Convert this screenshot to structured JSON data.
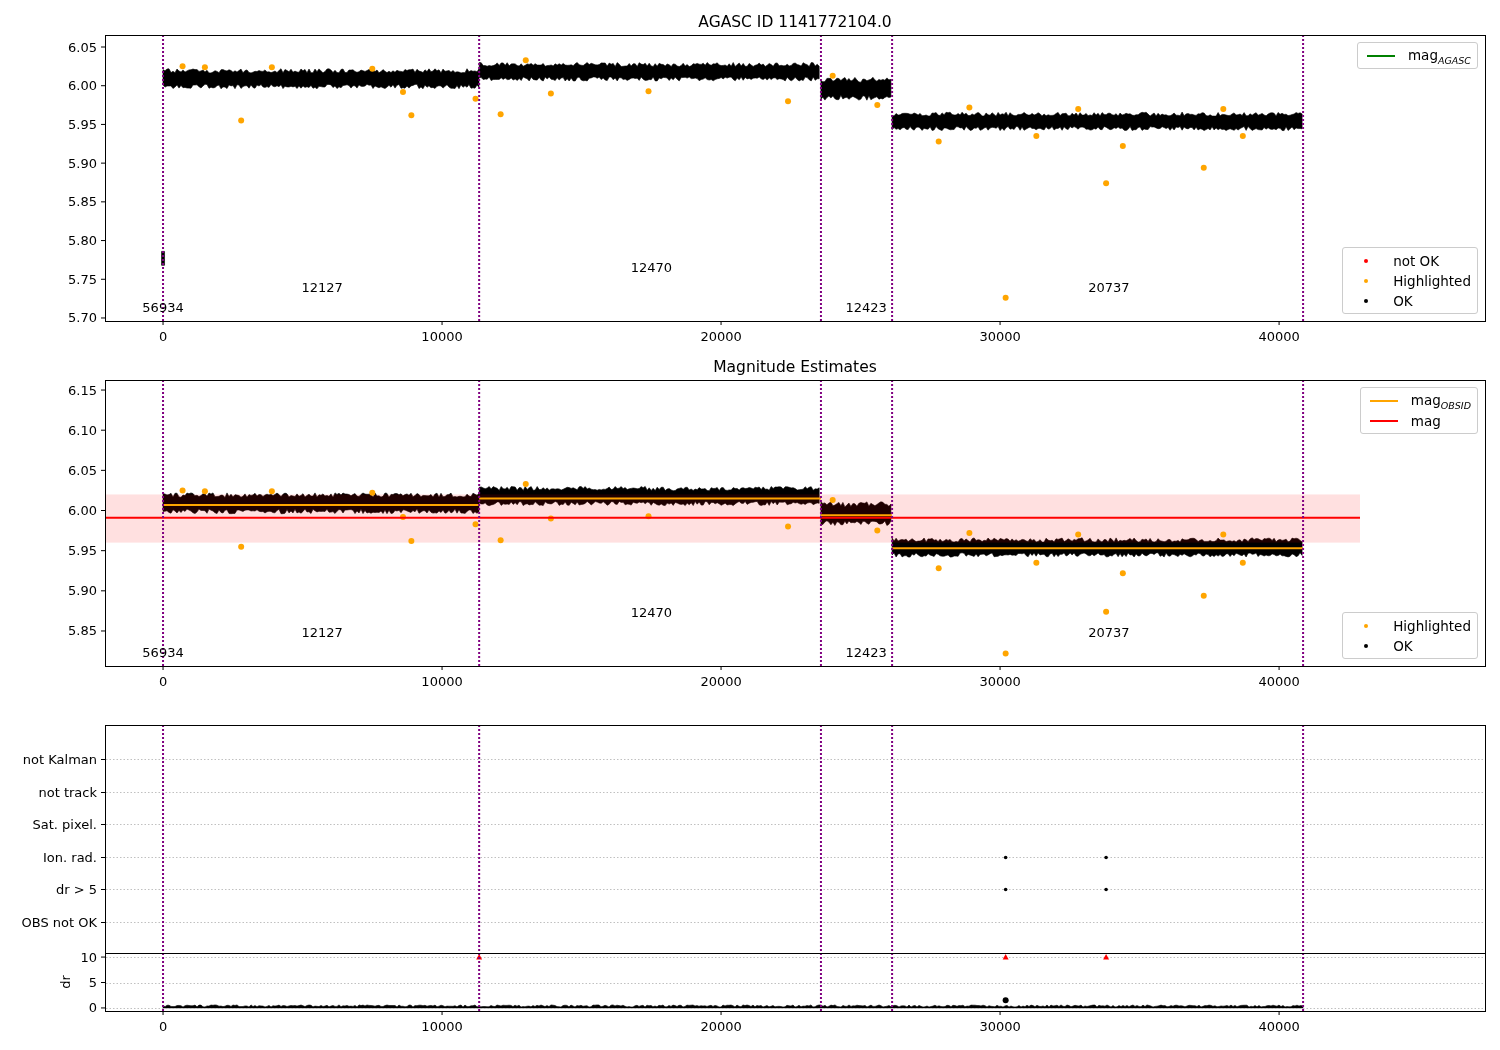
{
  "panels": [
    {
      "kind": "magnitude",
      "chart_data": {
        "type": "scatter",
        "title": "AGASC ID 1141772104.0",
        "xlim": [
          -2080,
          47380
        ],
        "ylim": [
          5.6961,
          6.0655
        ],
        "xticks": [
          {
            "value": 0,
            "label": "0"
          },
          {
            "value": 10000,
            "label": "10000"
          },
          {
            "value": 20000,
            "label": "20000"
          },
          {
            "value": 30000,
            "label": "30000"
          },
          {
            "value": 40000,
            "label": "40000"
          }
        ],
        "yticks": [
          {
            "value": 5.7,
            "label": "5.70"
          },
          {
            "value": 5.75,
            "label": "5.75"
          },
          {
            "value": 5.8,
            "label": "5.80"
          },
          {
            "value": 5.85,
            "label": "5.85"
          },
          {
            "value": 5.9,
            "label": "5.90"
          },
          {
            "value": 5.95,
            "label": "5.95"
          },
          {
            "value": 6.0,
            "label": "6.00"
          },
          {
            "value": 6.05,
            "label": "6.05"
          }
        ],
        "series": [
          {
            "color": "#ffa500",
            "marker": "circle",
            "x": [
              700,
              1500,
              2800,
              3900,
              7500,
              8600,
              8900,
              11200,
              12100,
              13000,
              13900,
              17400,
              22400,
              24000,
              25600,
              27800,
              28900,
              30200,
              31300,
              32800,
              33800,
              34400,
              37300,
              38000,
              38700
            ],
            "values": [
              6.025,
              6.024,
              5.955,
              6.024,
              6.022,
              5.992,
              5.962,
              5.983,
              5.963,
              6.033,
              5.99,
              5.993,
              5.98,
              6.013,
              5.975,
              5.928,
              5.972,
              5.726,
              5.935,
              5.97,
              5.874,
              5.922,
              5.894,
              5.97,
              5.935
            ]
          }
        ],
        "ref_lines": [
          {
            "axis": "x",
            "value": 0
          },
          {
            "axis": "x",
            "value": 11330
          },
          {
            "axis": "x",
            "value": 23580
          },
          {
            "axis": "x",
            "value": 26130
          },
          {
            "axis": "x",
            "value": 40860
          }
        ],
        "annotations": [
          "56934",
          "12127",
          "12470",
          "12423",
          "20737"
        ]
      },
      "legends": [
        {
          "entries": [
            {
              "label": "mag$_{AGASC}$",
              "color": "#008000",
              "kind": "line"
            }
          ]
        },
        {
          "entries": [
            {
              "label": "not OK",
              "color": "#ff0000",
              "kind": "dot"
            },
            {
              "label": "Highlighted",
              "color": "#ffa500",
              "kind": "dot"
            },
            {
              "label": "OK",
              "color": "#000000",
              "kind": "dot"
            }
          ]
        }
      ]
    },
    {
      "kind": "magnitude",
      "chart_data": {
        "type": "scatter",
        "title": "Magnitude Estimates",
        "xlim": [
          -2080,
          47380
        ],
        "ylim": [
          5.8064,
          6.1625
        ],
        "xticks": [
          {
            "value": 0,
            "label": "0"
          },
          {
            "value": 10000,
            "label": "10000"
          },
          {
            "value": 20000,
            "label": "20000"
          },
          {
            "value": 30000,
            "label": "30000"
          },
          {
            "value": 40000,
            "label": "40000"
          }
        ],
        "yticks": [
          {
            "value": 5.85,
            "label": "5.85"
          },
          {
            "value": 5.9,
            "label": "5.90"
          },
          {
            "value": 5.95,
            "label": "5.95"
          },
          {
            "value": 6.0,
            "label": "6.00"
          },
          {
            "value": 6.05,
            "label": "6.05"
          },
          {
            "value": 6.1,
            "label": "6.10"
          },
          {
            "value": 6.15,
            "label": "6.15"
          }
        ],
        "series": [
          {
            "color": "#ffa500",
            "marker": "circle",
            "x": [
              700,
              1500,
              2800,
              3900,
              7500,
              8600,
              8900,
              11200,
              12100,
              13000,
              13900,
              17400,
              22400,
              24000,
              25600,
              27800,
              28900,
              30200,
              31300,
              32800,
              33800,
              34400,
              37300,
              38000,
              38700
            ],
            "values": [
              6.025,
              6.024,
              5.955,
              6.024,
              6.022,
              5.992,
              5.962,
              5.983,
              5.963,
              6.033,
              5.99,
              5.993,
              5.98,
              6.013,
              5.975,
              5.928,
              5.972,
              5.822,
              5.935,
              5.97,
              5.874,
              5.922,
              5.894,
              5.97,
              5.935
            ]
          },
          {
            "type": "line",
            "color": "#ffa500",
            "x": [
              0,
              11330,
              null,
              11330,
              23580,
              null,
              23580,
              26130,
              null,
              26130,
              40860
            ],
            "values": [
              6.007,
              6.007,
              null,
              6.015,
              6.015,
              null,
              5.994,
              5.994,
              null,
              5.953,
              5.953
            ]
          },
          {
            "type": "line",
            "color": "#ff0000",
            "x": [
              -2080,
              42900
            ],
            "values": [
              5.991,
              5.991
            ]
          }
        ],
        "bands": [
          {
            "axis": "y",
            "from": 5.96,
            "to": 6.02
          }
        ],
        "ref_lines": [
          {
            "axis": "x",
            "value": 0
          },
          {
            "axis": "x",
            "value": 11330
          },
          {
            "axis": "x",
            "value": 23580
          },
          {
            "axis": "x",
            "value": 26130
          },
          {
            "axis": "x",
            "value": 40860
          }
        ],
        "annotations": [
          "56934",
          "12127",
          "12470",
          "12423",
          "20737"
        ]
      },
      "legends": [
        {
          "entries": [
            {
              "label": "mag$_{OBSID}$",
              "color": "#ffa500",
              "kind": "line"
            },
            {
              "label": "mag",
              "color": "#ff0000",
              "kind": "line"
            }
          ]
        },
        {
          "entries": [
            {
              "label": "Highlighted",
              "color": "#ffa500",
              "kind": "dot"
            },
            {
              "label": "OK",
              "color": "#000000",
              "kind": "dot"
            }
          ]
        }
      ]
    },
    {
      "kind": "flags",
      "labels": [
        "not Kalman",
        "not track",
        "Sat. pixel.",
        "Ion. rad.",
        "dr > 5",
        "OBS not OK"
      ]
    },
    {
      "kind": "dr",
      "chart_data": {
        "type": "scatter",
        "grid": true,
        "ylabel": "dr",
        "xlim": [
          -2080,
          47380
        ],
        "ylim": [
          -0.6,
          10.8
        ],
        "xticks": [
          {
            "value": 0,
            "label": "0"
          },
          {
            "value": 10000,
            "label": "10000"
          },
          {
            "value": 20000,
            "label": "20000"
          },
          {
            "value": 30000,
            "label": "30000"
          },
          {
            "value": 40000,
            "label": "40000"
          }
        ],
        "yticks": [
          {
            "value": 0,
            "label": "0"
          },
          {
            "value": 5,
            "label": "5"
          },
          {
            "value": 10,
            "label": "10"
          }
        ],
        "series": [
          {
            "color": "#ff0000",
            "marker": "triangle",
            "x": [
              11330,
              30200,
              33800
            ],
            "values": [
              10,
              10,
              10
            ]
          },
          {
            "color": "#000000",
            "marker": "circle",
            "x": [
              30200
            ],
            "values": [
              1.5
            ]
          }
        ],
        "ref_lines": [
          {
            "axis": "x",
            "value": 0
          },
          {
            "axis": "x",
            "value": 11330
          },
          {
            "axis": "x",
            "value": 23580
          },
          {
            "axis": "x",
            "value": 26130
          },
          {
            "axis": "x",
            "value": 40860
          }
        ]
      }
    }
  ]
}
